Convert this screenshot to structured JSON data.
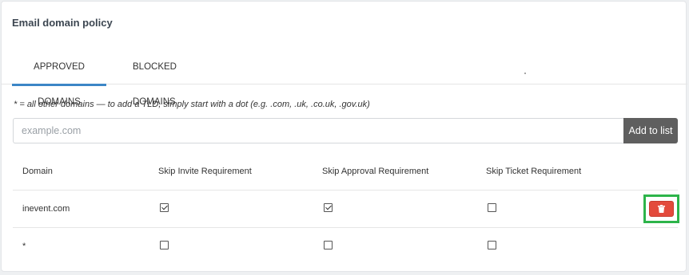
{
  "page": {
    "title": "Email domain policy"
  },
  "tabs": [
    {
      "label": "APPROVED DOMAINS",
      "active": true
    },
    {
      "label": "BLOCKED DOMAINS",
      "active": false
    }
  ],
  "hint": "* = all other domains — to add a TLD, simply start with a dot (e.g. .com, .uk, .co.uk, .gov.uk)",
  "input": {
    "placeholder": "example.com",
    "value": ""
  },
  "add_button": "Add to list",
  "table": {
    "headers": [
      "Domain",
      "Skip Invite Requirement",
      "Skip Approval Requirement",
      "Skip Ticket Requirement"
    ],
    "rows": [
      {
        "domain": "inevent.com",
        "skip_invite": true,
        "skip_approval": true,
        "skip_ticket": false,
        "deletable": true
      },
      {
        "domain": "*",
        "skip_invite": false,
        "skip_approval": false,
        "skip_ticket": false,
        "deletable": false
      }
    ]
  },
  "colors": {
    "accent": "#3c86c6",
    "delete": "#e34a3c",
    "highlight": "#2db44a",
    "add_button": "#5f5f5f"
  },
  "icons": {
    "delete": "trash-icon"
  }
}
